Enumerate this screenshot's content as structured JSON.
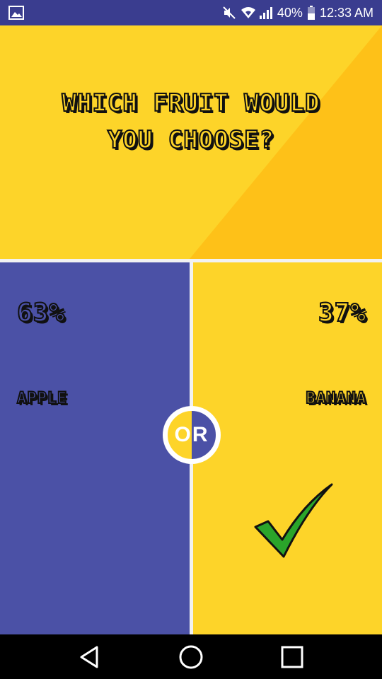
{
  "status_bar": {
    "battery": "40%",
    "time": "12:33 AM",
    "icons": [
      "image-icon",
      "mute-icon",
      "wifi-icon",
      "signal-icon",
      "battery-icon"
    ]
  },
  "question": {
    "line1": "Which fruit would",
    "line2": "you choose?"
  },
  "options": [
    {
      "percent": "63%",
      "label": "Apple",
      "color": "#4b51a6",
      "percent_value": 63
    },
    {
      "percent": "37%",
      "label": "Banana",
      "color": "#fdd429",
      "percent_value": 37,
      "selected": true
    }
  ],
  "divider": {
    "or_label": "OR"
  },
  "colors": {
    "yellow": "#fdd429",
    "yellow_dark": "#fec118",
    "blue": "#4b51a6",
    "status_bar": "#3a3d8f",
    "check": "#2aa52a"
  },
  "nav_bar": {
    "icons": [
      "back-icon",
      "home-icon",
      "recent-apps-icon"
    ]
  }
}
